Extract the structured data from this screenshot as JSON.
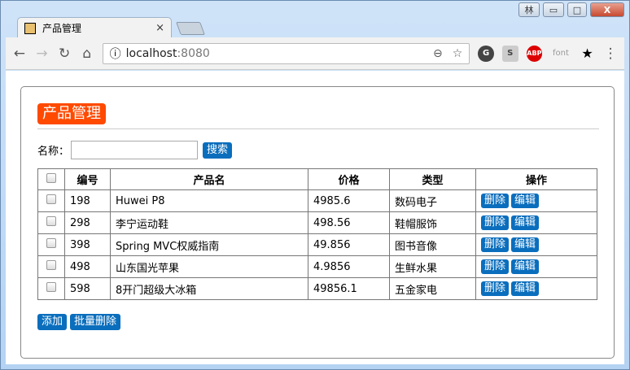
{
  "window": {
    "user_badge": "林",
    "minimize": "▭",
    "maximize": "□",
    "close": "X"
  },
  "tab": {
    "title": "产品管理",
    "close": "×"
  },
  "toolbar": {
    "back": "←",
    "forward": "→",
    "reload": "↻",
    "home": "⌂",
    "info": "ⓘ",
    "host": "localhost",
    "port": ":8080",
    "zoom": "⊖",
    "star": "☆",
    "ext_g": "G",
    "ext_s": "S",
    "ext_abp": "ABP",
    "ext_font": "font",
    "ext_star": "★",
    "menu": "⋮"
  },
  "page": {
    "title": "产品管理",
    "search_label": "名称：",
    "search_value": "",
    "search_button": "搜索",
    "columns": [
      "编号",
      "产品名",
      "价格",
      "类型",
      "操作"
    ],
    "rows": [
      {
        "id": "198",
        "name": "Huwei P8",
        "price": "4985.6",
        "type": "数码电子"
      },
      {
        "id": "298",
        "name": "李宁运动鞋",
        "price": "498.56",
        "type": "鞋帽服饰"
      },
      {
        "id": "398",
        "name": "Spring MVC权威指南",
        "price": "49.856",
        "type": "图书音像"
      },
      {
        "id": "498",
        "name": "山东国光苹果",
        "price": "4.9856",
        "type": "生鲜水果"
      },
      {
        "id": "598",
        "name": "8开门超级大冰箱",
        "price": "49856.1",
        "type": "五金家电"
      }
    ],
    "delete_label": "删除",
    "edit_label": "编辑",
    "add_button": "添加",
    "batch_delete_button": "批量删除"
  }
}
